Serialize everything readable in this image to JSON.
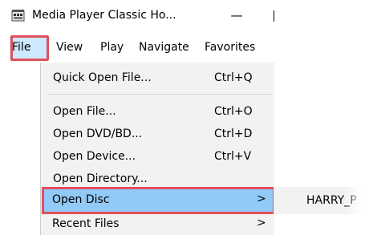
{
  "window": {
    "title": "Media Player Classic Ho...",
    "minimize_glyph": "—"
  },
  "menubar": {
    "items": [
      {
        "label": "File"
      },
      {
        "label": "View"
      },
      {
        "label": "Play"
      },
      {
        "label": "Navigate"
      },
      {
        "label": "Favorites"
      }
    ]
  },
  "file_menu": {
    "items": [
      {
        "label": "Quick Open File...",
        "shortcut": "Ctrl+Q"
      },
      {
        "label": "Open File...",
        "shortcut": "Ctrl+O"
      },
      {
        "label": "Open DVD/BD...",
        "shortcut": "Ctrl+D"
      },
      {
        "label": "Open Device...",
        "shortcut": "Ctrl+V"
      },
      {
        "label": "Open Directory...",
        "shortcut": ""
      },
      {
        "label": "Open Disc",
        "shortcut": "",
        "submenu_arrow": ">"
      },
      {
        "label": "Recent Files",
        "shortcut": "",
        "submenu_arrow": ">"
      }
    ]
  },
  "submenu": {
    "items": [
      {
        "label": "HARRY_P"
      }
    ]
  },
  "colors": {
    "highlight_outline": "#e0505a",
    "selected_item_bg": "#91c9f7",
    "menu_active_bg": "#cde8ff",
    "menu_bg": "#f2f2f2"
  },
  "icons": {
    "app_icon": "media-player-icon",
    "submenu_arrow": "chevron-right-icon"
  }
}
